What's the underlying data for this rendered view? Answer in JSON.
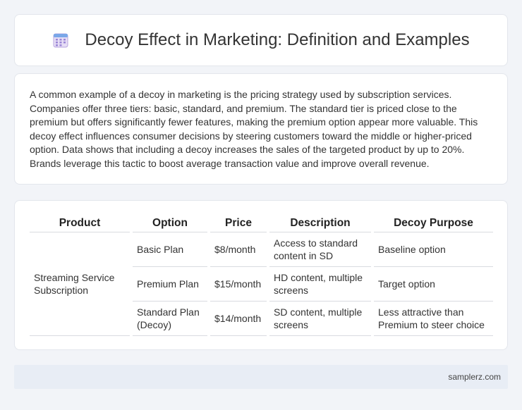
{
  "header": {
    "title": "Decoy Effect in Marketing: Definition and Examples",
    "icon": "calendar-icon"
  },
  "intro": {
    "text": "A common example of a decoy in marketing is the pricing strategy used by subscription services. Companies offer three tiers: basic, standard, and premium. The standard tier is priced close to the premium but offers significantly fewer features, making the premium option appear more valuable. This decoy effect influences consumer decisions by steering customers toward the middle or higher-priced option. Data shows that including a decoy increases the sales of the targeted product by up to 20%. Brands leverage this tactic to boost average transaction value and improve overall revenue."
  },
  "table": {
    "headers": [
      "Product",
      "Option",
      "Price",
      "Description",
      "Decoy Purpose"
    ],
    "product": "Streaming Service Subscription",
    "rows": [
      {
        "option": "Basic Plan",
        "price": "$8/month",
        "description": "Access to standard content in SD",
        "purpose": "Baseline option"
      },
      {
        "option": "Premium Plan",
        "price": "$15/month",
        "description": "HD content, multiple screens",
        "purpose": "Target option"
      },
      {
        "option": "Standard Plan (Decoy)",
        "price": "$14/month",
        "description": "SD content, multiple screens",
        "purpose": "Less attractive than Premium to steer choice"
      }
    ]
  },
  "footer": {
    "site": "samplerz.com"
  }
}
